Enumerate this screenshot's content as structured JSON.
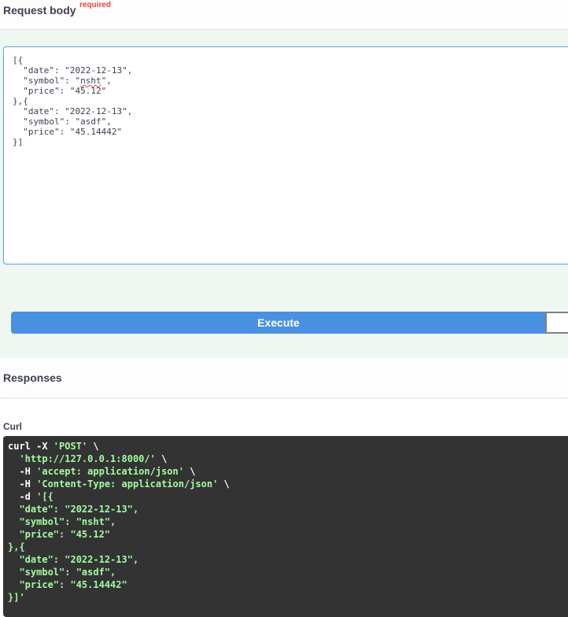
{
  "request_body": {
    "title": "Request body",
    "required_label": "required",
    "editor_value": "[{\n  \"date\": \"2022-12-13\",\n  \"symbol\": \"nsht\",\n  \"price\": \"45.12\"\n},{\n  \"date\": \"2022-12-13\",\n  \"symbol\": \"asdf\",\n  \"price\": \"45.14442\"\n}]"
  },
  "actions": {
    "execute_label": "Execute"
  },
  "responses": {
    "title": "Responses",
    "curl_label": "Curl",
    "curl_lines": [
      {
        "cmd": "curl -X ",
        "str": "'POST'",
        "tail": " \\"
      },
      {
        "cmd": "  ",
        "str": "'http://127.0.0.1:8000/'",
        "tail": " \\"
      },
      {
        "cmd": "  -H ",
        "str": "'accept: application/json'",
        "tail": " \\"
      },
      {
        "cmd": "  -H ",
        "str": "'Content-Type: application/json'",
        "tail": " \\"
      },
      {
        "cmd": "  -d ",
        "str": "'[{",
        "tail": ""
      },
      {
        "cmd": "",
        "str": "  \"date\": \"2022-12-13\",",
        "tail": ""
      },
      {
        "cmd": "",
        "str": "  \"symbol\": \"nsht\",",
        "tail": ""
      },
      {
        "cmd": "",
        "str": "  \"price\": \"45.12\"",
        "tail": ""
      },
      {
        "cmd": "",
        "str": "},{",
        "tail": ""
      },
      {
        "cmd": "",
        "str": "  \"date\": \"2022-12-13\",",
        "tail": ""
      },
      {
        "cmd": "",
        "str": "  \"symbol\": \"asdf\",",
        "tail": ""
      },
      {
        "cmd": "",
        "str": "  \"price\": \"45.14442\"",
        "tail": ""
      },
      {
        "cmd": "",
        "str": "}]'",
        "tail": ""
      }
    ]
  },
  "colors": {
    "execute_bg": "#4990e2",
    "required": "#f93e3e",
    "curl_bg": "#333333",
    "curl_string": "#a2fca2",
    "panel_bg": "#eff7f1"
  }
}
